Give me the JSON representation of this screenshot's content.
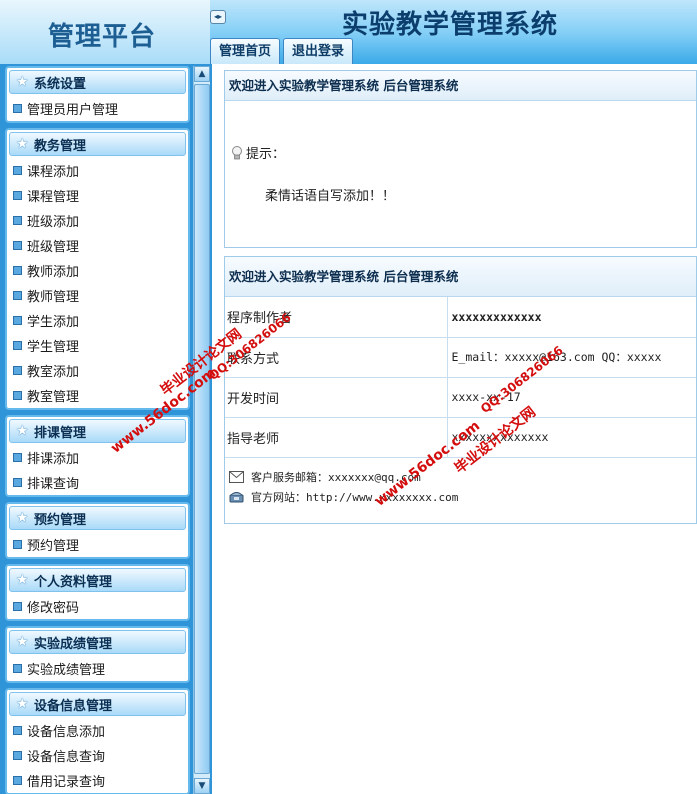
{
  "header": {
    "logo": "管理平台",
    "system_title": "实验教学管理系统",
    "toggle_icon": "◂▸",
    "tabs": [
      {
        "label": "管理首页"
      },
      {
        "label": "退出登录"
      }
    ]
  },
  "sidebar": {
    "groups": [
      {
        "title": "系统设置",
        "items": [
          "管理员用户管理"
        ]
      },
      {
        "title": "教务管理",
        "items": [
          "课程添加",
          "课程管理",
          "班级添加",
          "班级管理",
          "教师添加",
          "教师管理",
          "学生添加",
          "学生管理",
          "教室添加",
          "教室管理"
        ]
      },
      {
        "title": "排课管理",
        "items": [
          "排课添加",
          "排课查询"
        ]
      },
      {
        "title": "预约管理",
        "items": [
          "预约管理"
        ]
      },
      {
        "title": "个人资料管理",
        "items": [
          "修改密码"
        ]
      },
      {
        "title": "实验成绩管理",
        "items": [
          "实验成绩管理"
        ]
      },
      {
        "title": "设备信息管理",
        "items": [
          "设备信息添加",
          "设备信息查询",
          "借用记录查询"
        ]
      }
    ]
  },
  "main": {
    "welcome_panel": {
      "title": "欢迎进入实验教学管理系统  后台管理系统",
      "hint_label": "提示：",
      "message": "柔情话语自写添加！！"
    },
    "info_panel": {
      "title": "欢迎进入实验教学管理系统  后台管理系统",
      "rows": [
        {
          "key": "程序制作者",
          "value": "xxxxxxxxxxxxx"
        },
        {
          "key": "联系方式",
          "value": "E_mail：xxxxx@163.com QQ：xxxxx"
        },
        {
          "key": "开发时间",
          "value": "xxxx-xx-17"
        },
        {
          "key": "指导老师",
          "value": "xxxxxxxxxxxxxx"
        }
      ],
      "email_line": "客户服务邮箱：xxxxxxx@qq.com",
      "website_line": "官方网站：http://www.xxxxxxxx.com"
    }
  },
  "watermarks": [
    {
      "text1": "毕业设计论文网",
      "text2": "www.56doc.com",
      "text3": "QQ:306826066"
    },
    {
      "text1": "毕业设计论文网",
      "text2": "www.56doc.com",
      "text3": "QQ:306826066"
    }
  ]
}
